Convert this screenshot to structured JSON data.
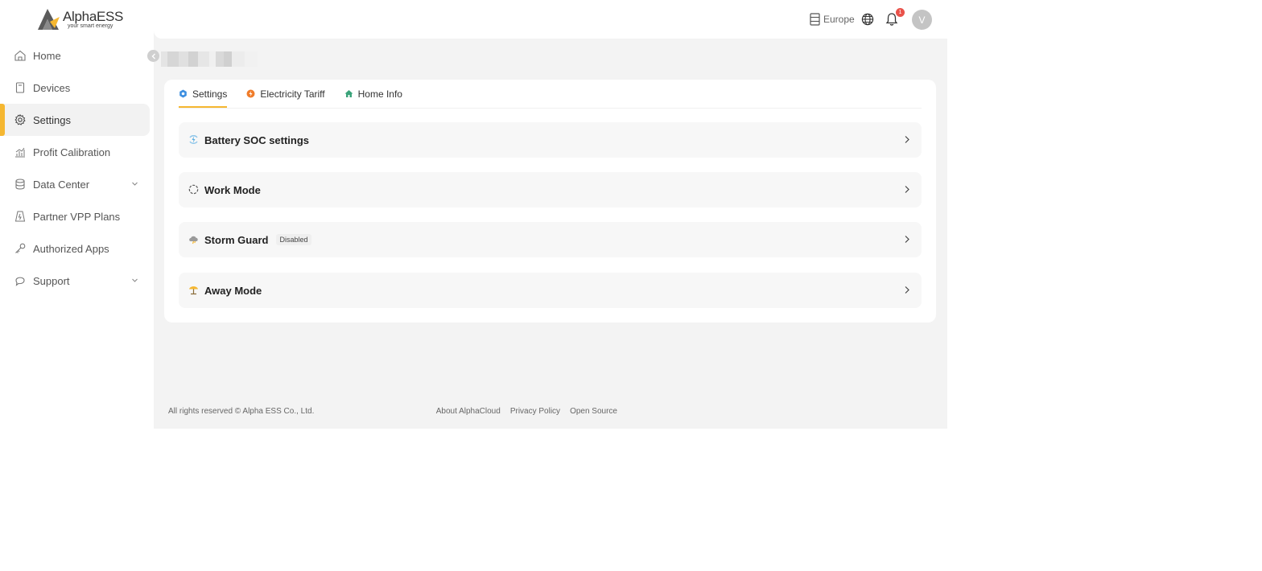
{
  "brand": {
    "name": "AlphaESS",
    "tagline": "your smart energy",
    "accent_color": "#f5b731"
  },
  "sidebar": {
    "items": [
      {
        "label": "Home",
        "icon": "home-icon"
      },
      {
        "label": "Devices",
        "icon": "device-icon"
      },
      {
        "label": "Settings",
        "icon": "gear-icon",
        "active": true
      },
      {
        "label": "Profit Calibration",
        "icon": "chart-icon"
      },
      {
        "label": "Data Center",
        "icon": "database-icon",
        "expandable": true
      },
      {
        "label": "Partner VPP Plans",
        "icon": "vpp-icon"
      },
      {
        "label": "Authorized Apps",
        "icon": "key-icon"
      },
      {
        "label": "Support",
        "icon": "support-icon",
        "expandable": true
      }
    ]
  },
  "header": {
    "region": "Europe",
    "notification_count": "1",
    "avatar_initial": "V"
  },
  "tabs": [
    {
      "label": "Settings",
      "icon": "settings-icon",
      "color": "#3d8fe0",
      "active": true
    },
    {
      "label": "Electricity Tariff",
      "icon": "tariff-icon",
      "color": "#f07c2a"
    },
    {
      "label": "Home Info",
      "icon": "home-icon",
      "color": "#3aa37a"
    }
  ],
  "settings_rows": [
    {
      "title": "Battery SOC settings",
      "icon": "battery-soc-icon"
    },
    {
      "title": "Work Mode",
      "icon": "work-mode-icon"
    },
    {
      "title": "Storm Guard",
      "icon": "storm-cloud-icon",
      "badge": "Disabled"
    },
    {
      "title": "Away Mode",
      "icon": "beach-umbrella-icon"
    }
  ],
  "footer": {
    "copyright": "All rights reserved © Alpha ESS Co., Ltd.",
    "links": [
      "About AlphaCloud",
      "Privacy Policy",
      "Open Source"
    ]
  }
}
